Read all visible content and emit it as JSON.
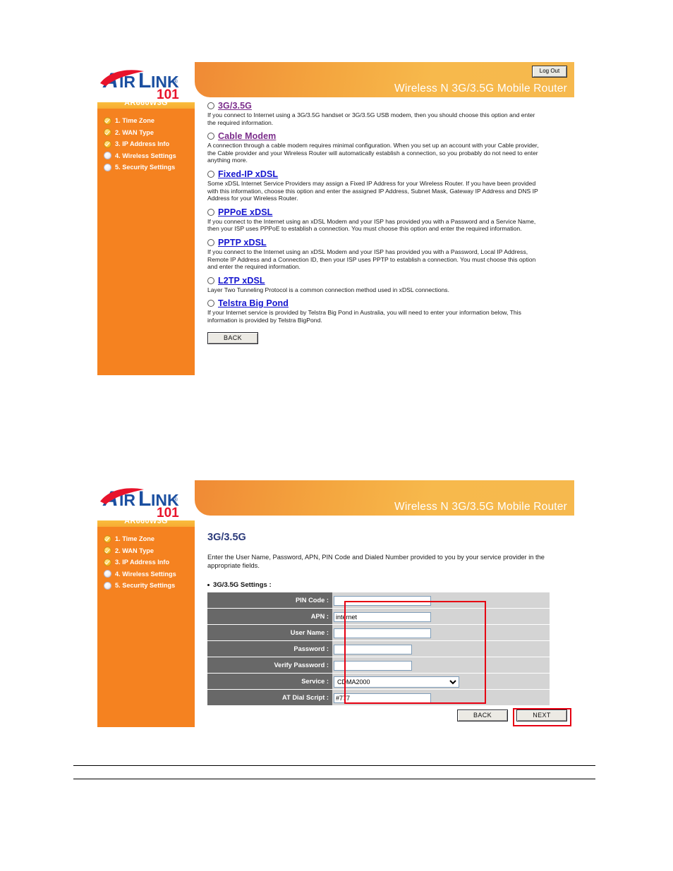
{
  "brand": {
    "logo_main": "AIRLINK",
    "logo_sub": "101",
    "registered_mark": "®"
  },
  "panel1": {
    "header": {
      "title": "Wireless N 3G/3.5G Mobile Router",
      "logout_label": "Log Out"
    },
    "sidebar": {
      "model": "AR660W3G",
      "items": [
        {
          "label": "1. Time Zone",
          "state": "done"
        },
        {
          "label": "2. WAN Type",
          "state": "done"
        },
        {
          "label": "3. IP Address Info",
          "state": "done"
        },
        {
          "label": "4. Wireless Settings",
          "state": "todo"
        },
        {
          "label": "5. Security Settings",
          "state": "todo"
        }
      ]
    },
    "wan_options": [
      {
        "name": "3G/3.5G",
        "link_state": "visited",
        "desc": "If you connect to Internet using a 3G/3.5G handset or 3G/3.5G USB modem, then you should choose this option and enter the required information."
      },
      {
        "name": "Cable Modem",
        "link_state": "visited",
        "desc": "A connection through a cable modem requires minimal configuration. When you set up an account with your Cable provider, the Cable provider and your Wireless Router will automatically establish a connection, so you probably do not need to enter anything more."
      },
      {
        "name": "Fixed-IP xDSL",
        "link_state": "fresh",
        "desc": "Some xDSL Internet Service Providers may assign a Fixed IP Address for your Wireless Router. If you have been provided with this information, choose this option and enter the assigned IP Address, Subnet Mask, Gateway IP Address and DNS IP Address for your Wireless Router."
      },
      {
        "name": "PPPoE xDSL",
        "link_state": "fresh",
        "desc": "If you connect to the Internet using an xDSL Modem and your ISP has provided you with a Password and a Service Name, then your ISP uses PPPoE to establish a connection. You must choose this option and enter the required information."
      },
      {
        "name": "PPTP xDSL",
        "link_state": "fresh",
        "desc": "If you connect to the Internet using an xDSL Modem and your ISP has provided you with a Password, Local IP Address, Remote IP Address and a Connection ID, then your ISP uses PPTP to establish a connection. You must choose this option and enter the required information."
      },
      {
        "name": "L2TP xDSL",
        "link_state": "fresh",
        "desc": "Layer Two Tunneling Protocol is a common connection method used in xDSL connections."
      },
      {
        "name": "Telstra Big Pond",
        "link_state": "fresh",
        "desc": "If your Internet service is provided by Telstra Big Pond in Australia, you will need to enter your information below, This information is provided by Telstra BigPond."
      }
    ],
    "back_label": "BACK"
  },
  "panel2": {
    "header": {
      "title": "Wireless N 3G/3.5G Mobile Router"
    },
    "sidebar": {
      "model": "AR660W3G",
      "items": [
        {
          "label": "1. Time Zone",
          "state": "done"
        },
        {
          "label": "2. WAN Type",
          "state": "done"
        },
        {
          "label": "3. IP Address Info",
          "state": "done"
        },
        {
          "label": "4. Wireless Settings",
          "state": "todo"
        },
        {
          "label": "5. Security Settings",
          "state": "todo"
        }
      ]
    },
    "section_title": "3G/3.5G",
    "section_desc": "Enter the User Name, Password, APN, PIN Code and Dialed Number provided to you by your service provider in the appropriate fields.",
    "group_title": "3G/3.5G Settings :",
    "fields": [
      {
        "label": "PIN Code :",
        "value": "",
        "type": "text",
        "width": "long"
      },
      {
        "label": "APN :",
        "value": "internet",
        "type": "text",
        "width": "long"
      },
      {
        "label": "User Name :",
        "value": "",
        "type": "text",
        "width": "long"
      },
      {
        "label": "Password :",
        "value": "",
        "type": "text",
        "width": "short"
      },
      {
        "label": "Verify Password :",
        "value": "",
        "type": "text",
        "width": "short"
      },
      {
        "label": "Service :",
        "value": "CDMA2000",
        "type": "select",
        "width": "long"
      },
      {
        "label": "AT Dial Script :",
        "value": "#777",
        "type": "text",
        "width": "long"
      }
    ],
    "service_options": [
      "CDMA2000"
    ],
    "back_label": "BACK",
    "next_label": "NEXT"
  },
  "colors": {
    "orange": "#f58220",
    "header_gradient_start": "#f08a35",
    "header_gradient_end": "#f6b94e",
    "label_gray": "#686868",
    "field_bg_gray": "#d4d4d4",
    "highlight_red": "#e60012",
    "link_blue": "#1414cf",
    "link_visited": "#7b2d8b",
    "title_navy": "#2b3a7a"
  }
}
